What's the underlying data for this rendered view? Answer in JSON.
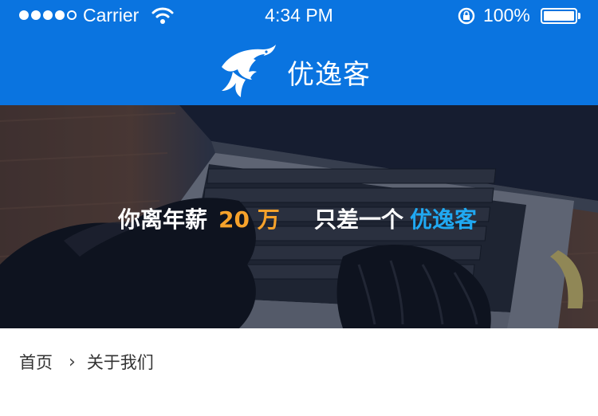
{
  "status_bar": {
    "carrier": "Carrier",
    "time": "4:34 PM",
    "battery_percent": "100%",
    "signal_bars": 4,
    "signal_total": 5,
    "icons": [
      "wifi-icon",
      "rotation-lock-icon",
      "battery-icon"
    ]
  },
  "header": {
    "app_name": "优逸客",
    "logo_icon": "dolphin-logo-icon",
    "background_color": "#0a74e0"
  },
  "banner": {
    "text_part1": "你离年薪",
    "text_highlight1": "20 万",
    "text_part2": "只差一个",
    "text_highlight2": "优逸客",
    "highlight1_color": "#f6a22b",
    "highlight2_color": "#20a9f2"
  },
  "breadcrumb": {
    "home": "首页",
    "separator": "›",
    "current": "关于我们"
  }
}
